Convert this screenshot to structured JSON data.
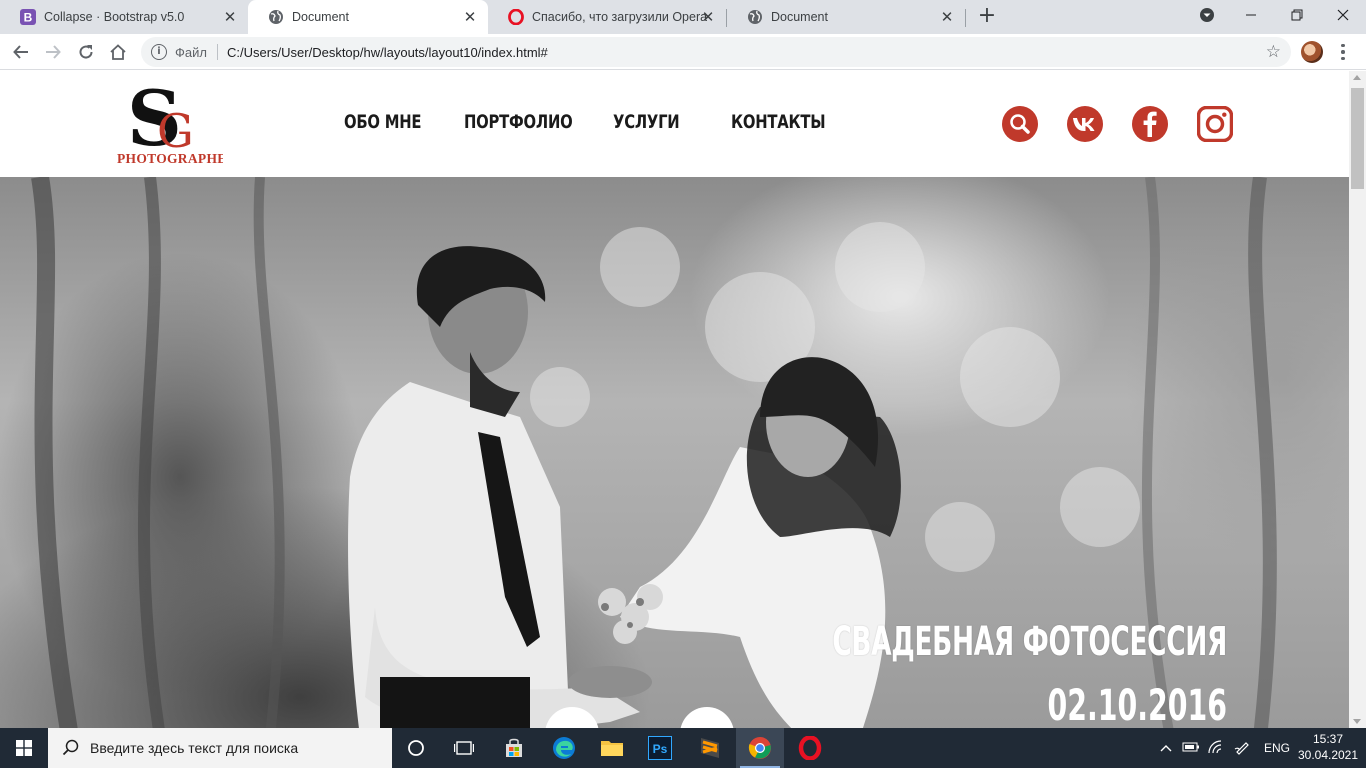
{
  "browser": {
    "tabs": [
      {
        "title": "Collapse · Bootstrap v5.0",
        "favicon": "bootstrap-icon",
        "active": false
      },
      {
        "title": "Document",
        "favicon": "globe-icon",
        "active": true
      },
      {
        "title": "Спасибо, что загрузили Opera",
        "favicon": "opera-icon",
        "active": false
      },
      {
        "title": "Document",
        "favicon": "globe-icon",
        "active": false
      }
    ],
    "new_tab": "+",
    "address": {
      "scheme_label": "Файл",
      "url": "C:/Users/User/Desktop/hw/layouts/layout10/index.html#"
    }
  },
  "site": {
    "logo": {
      "monogram_s": "S",
      "monogram_g": "G",
      "wordmark": "PHOTOGRAPHER"
    },
    "nav": [
      "ОБО МНЕ",
      "ПОРТФОЛИО",
      "УСЛУГИ",
      "КОНТАКТЫ"
    ],
    "social": [
      "search-icon",
      "vk-icon",
      "facebook-icon",
      "instagram-icon"
    ],
    "hero": {
      "title": "СВАДЕБНАЯ ФОТОСЕССИЯ",
      "date": "02.10.2016"
    },
    "accent_color": "#c0392b"
  },
  "taskbar": {
    "search_placeholder": "Введите здесь текст для поиска",
    "apps": [
      "cortana-icon",
      "task-view-icon",
      "store-icon",
      "edge-icon",
      "file-explorer-icon",
      "photoshop-icon",
      "sublime-text-icon",
      "chrome-icon",
      "opera-icon"
    ],
    "photoshop_label": "Ps",
    "language": "ENG",
    "time": "15:37",
    "date": "30.04.2021"
  }
}
